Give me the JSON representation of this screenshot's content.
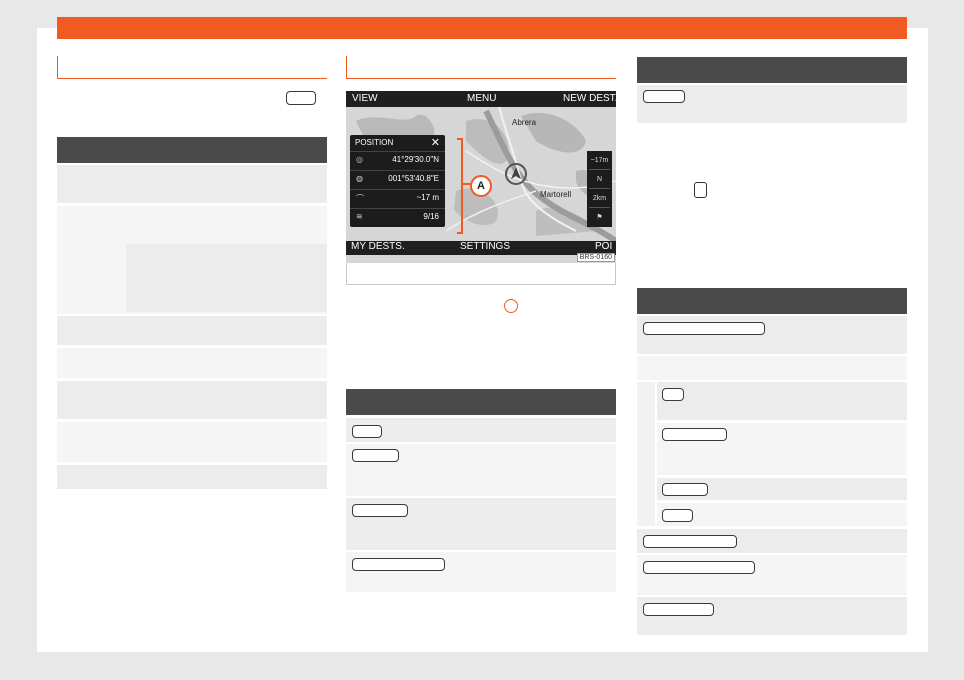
{
  "map": {
    "top_labels": [
      "VIEW",
      "MENU",
      "NEW DEST."
    ],
    "bottom_labels": [
      "MY DESTS.",
      "SETTINGS",
      "POI"
    ],
    "places": [
      "Abrera",
      "Martorell"
    ],
    "position_panel": {
      "title": "POSITION",
      "close": "✕",
      "rows": [
        {
          "icon": "◎",
          "value": "41°29'30.0\"N"
        },
        {
          "icon": "◍",
          "value": "001°53'40.8\"E"
        },
        {
          "icon": "⌒",
          "value": "~17 m"
        },
        {
          "icon": "≋",
          "value": "9/16"
        }
      ]
    },
    "side_icons": [
      "~17m",
      "N",
      "2km",
      "⚑"
    ],
    "callout": "A",
    "image_code": "BRS-0160"
  },
  "colors": {
    "accent": "#f15a22",
    "header_dark": "#4a4a4a",
    "row_gray": "#ececec",
    "map_bars": "#1f1f1f"
  }
}
